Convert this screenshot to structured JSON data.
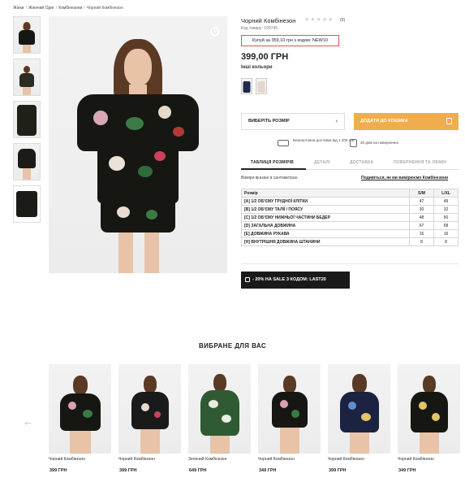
{
  "breadcrumb": {
    "items": [
      "Жінки",
      "Жіночий Одяг",
      "Комбінезони",
      "Чорний Комбінезон"
    ]
  },
  "product": {
    "title": "Чорний Комбінезон",
    "rating_stars": "★★★★★",
    "reviews": "(0)",
    "code": "Код товару: 100745",
    "promo": "Купуй за 359,10 грн з кодом: NEW10",
    "price": "399,00 ГРН",
    "other_colors_label": "Інші кольори",
    "size_button": "ВИБЕРІТЬ РОЗМІР",
    "cart_button": "ДОДАТИ ДО КОШИКА",
    "delivery": "Безкоштовна доставка від 1 200 грн",
    "return": "30 днів на повернення"
  },
  "tabs": [
    "ТАБЛИЦЯ РОЗМІРІВ",
    "ДЕТАЛІ",
    "ДОСТАВКА",
    "ПОВЕРНЕННЯ ТА ОБМІН"
  ],
  "size_table": {
    "note": "Виміри вказані в сантиметрах.",
    "how_link": "Подивіться, як ми вимірюємо Комбінезони",
    "headers": [
      "Розмір",
      "S/M",
      "L/XL"
    ],
    "rows": [
      {
        "label": "[А] 1/2 ОБ'ЄМУ ГРУДНОЇ КЛІТКИ",
        "sm": "47",
        "lxl": "49"
      },
      {
        "label": "[B] 1/2 ОБ'ЄМУ ТАЛІЇ / ПОЯСУ",
        "sm": "30",
        "lxl": "32"
      },
      {
        "label": "[C] 1/2 ОБ'ЄМУ НИЖНЬОЇ ЧАСТИНИ БЕДЕР",
        "sm": "48",
        "lxl": "50"
      },
      {
        "label": "[D] ЗАГАЛЬНА ДОВЖИНА",
        "sm": "67",
        "lxl": "68"
      },
      {
        "label": "[E] ДОВЖИНА РУКАВА",
        "sm": "16",
        "lxl": "16"
      },
      {
        "label": "[H] ВНУТРІШНЯ ДОВЖИНА ШТАНИНИ",
        "sm": "8",
        "lxl": "8"
      }
    ]
  },
  "banner": "- 20% НА SALE З КОДОМ: LAST20",
  "recommend": {
    "title": "ВИБРАНЕ ДЛЯ ВАС",
    "arrow": "←",
    "items": [
      {
        "name": "Чорний Комбінезон",
        "price": "399 ГРН"
      },
      {
        "name": "Чорний Комбінезон",
        "price": "399 ГРН"
      },
      {
        "name": "Зелений Комбінезон",
        "price": "649 ГРН"
      },
      {
        "name": "Чорний Комбінезон",
        "price": "349 ГРН"
      },
      {
        "name": "Чорний Комбінезон",
        "price": "399 ГРН"
      },
      {
        "name": "Чорний Комбінезон",
        "price": "349 ГРН"
      }
    ]
  },
  "colors": {
    "accent": "#f0ad4e",
    "promo_border": "#e0554a",
    "banner": "#1a1a1a"
  }
}
